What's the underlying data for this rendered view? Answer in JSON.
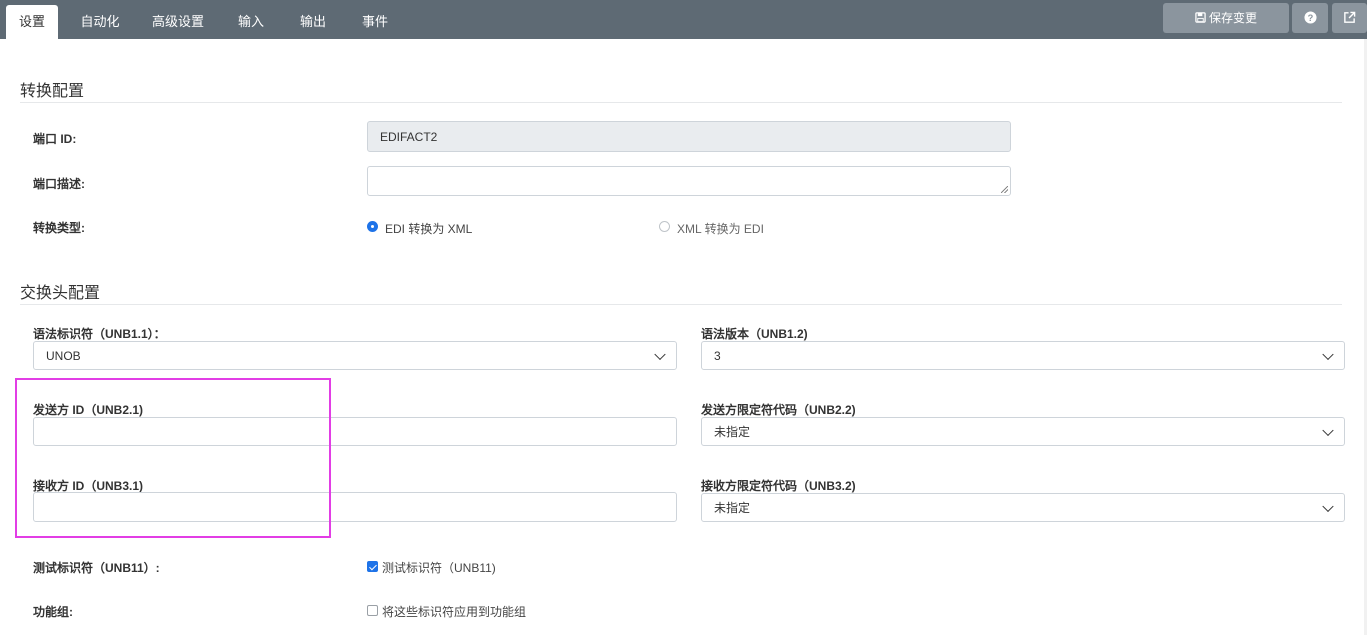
{
  "tabs": [
    "设置",
    "自动化",
    "高级设置",
    "输入",
    "输出",
    "事件"
  ],
  "toolbar": {
    "save_label": "保存变更",
    "help_icon": "question-circle-icon",
    "external_icon": "external-link-icon"
  },
  "conversion": {
    "title": "转换配置",
    "port_id_label": "端口 ID:",
    "port_id_value": "EDIFACT2",
    "port_desc_label": "端口描述:",
    "port_desc_value": "",
    "type_label": "转换类型:",
    "type_options": [
      "EDI 转换为 XML",
      "XML 转换为 EDI"
    ],
    "type_selected": "EDI 转换为 XML"
  },
  "interchange": {
    "title": "交换头配置",
    "syntax_id_label": "语法标识符（UNB1.1）：",
    "syntax_id_value": "UNOB",
    "syntax_version_label": "语法版本（UNB1.2)",
    "syntax_version_value": "3",
    "sender_id_label": "发送方 ID（UNB2.1)",
    "sender_id_value": "",
    "sender_qualifier_label": "发送方限定符代码（UNB2.2)",
    "sender_qualifier_value": "未指定",
    "receiver_id_label": "接收方 ID（UNB3.1)",
    "receiver_id_value": "",
    "receiver_qualifier_label": "接收方限定符代码（UNB3.2)",
    "receiver_qualifier_value": "未指定",
    "test_label": "测试标识符（UNB11）:",
    "test_checkbox_label": "测试标识符（UNB11)",
    "test_checked": true,
    "func_group_label": "功能组:",
    "func_group_checkbox_label": "将这些标识符应用到功能组",
    "func_group_checked": false
  },
  "colors": {
    "topbar": "#5e6a74",
    "accent": "#1e73e8",
    "highlight": "#e23de5"
  }
}
